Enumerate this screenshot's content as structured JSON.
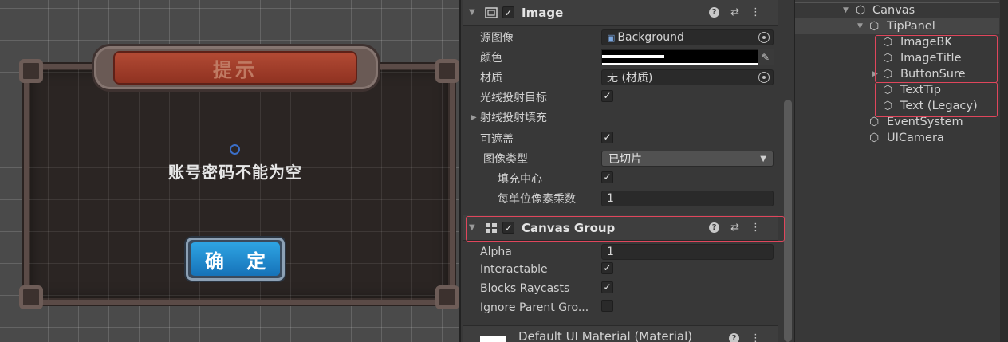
{
  "scene": {
    "title_text": "提示",
    "tip_text": "账号密码不能为空",
    "button_label": "确 定"
  },
  "inspector": {
    "image_component": {
      "title": "Image",
      "source_image_label": "源图像",
      "source_image_value": "Background",
      "color_label": "颜色",
      "material_label": "材质",
      "material_value": "无 (材质)",
      "raycast_target_label": "光线投射目标",
      "raycast_padding_label": "射线投射填充",
      "maskable_label": "可遮盖",
      "image_type_label": "图像类型",
      "image_type_value": "已切片",
      "fill_center_label": "填充中心",
      "ppu_multiplier_label": "每单位像素乘数",
      "ppu_multiplier_value": "1"
    },
    "canvas_group": {
      "title": "Canvas Group",
      "alpha_label": "Alpha",
      "alpha_value": "1",
      "interactable_label": "Interactable",
      "blocks_raycasts_label": "Blocks Raycasts",
      "ignore_parent_label": "Ignore Parent Gro..."
    },
    "material_footer": "Default UI Material (Material)"
  },
  "hierarchy": {
    "items": [
      {
        "label": "Canvas"
      },
      {
        "label": "TipPanel"
      },
      {
        "label": "ImageBK"
      },
      {
        "label": "ImageTitle"
      },
      {
        "label": "ButtonSure"
      },
      {
        "label": "TextTip"
      },
      {
        "label": "Text (Legacy)"
      },
      {
        "label": "EventSystem"
      },
      {
        "label": "UICamera"
      }
    ]
  },
  "colors": {
    "highlight_box": "#e0465c",
    "button_blue": "#1f8fd6",
    "title_red": "#a53f2c"
  }
}
